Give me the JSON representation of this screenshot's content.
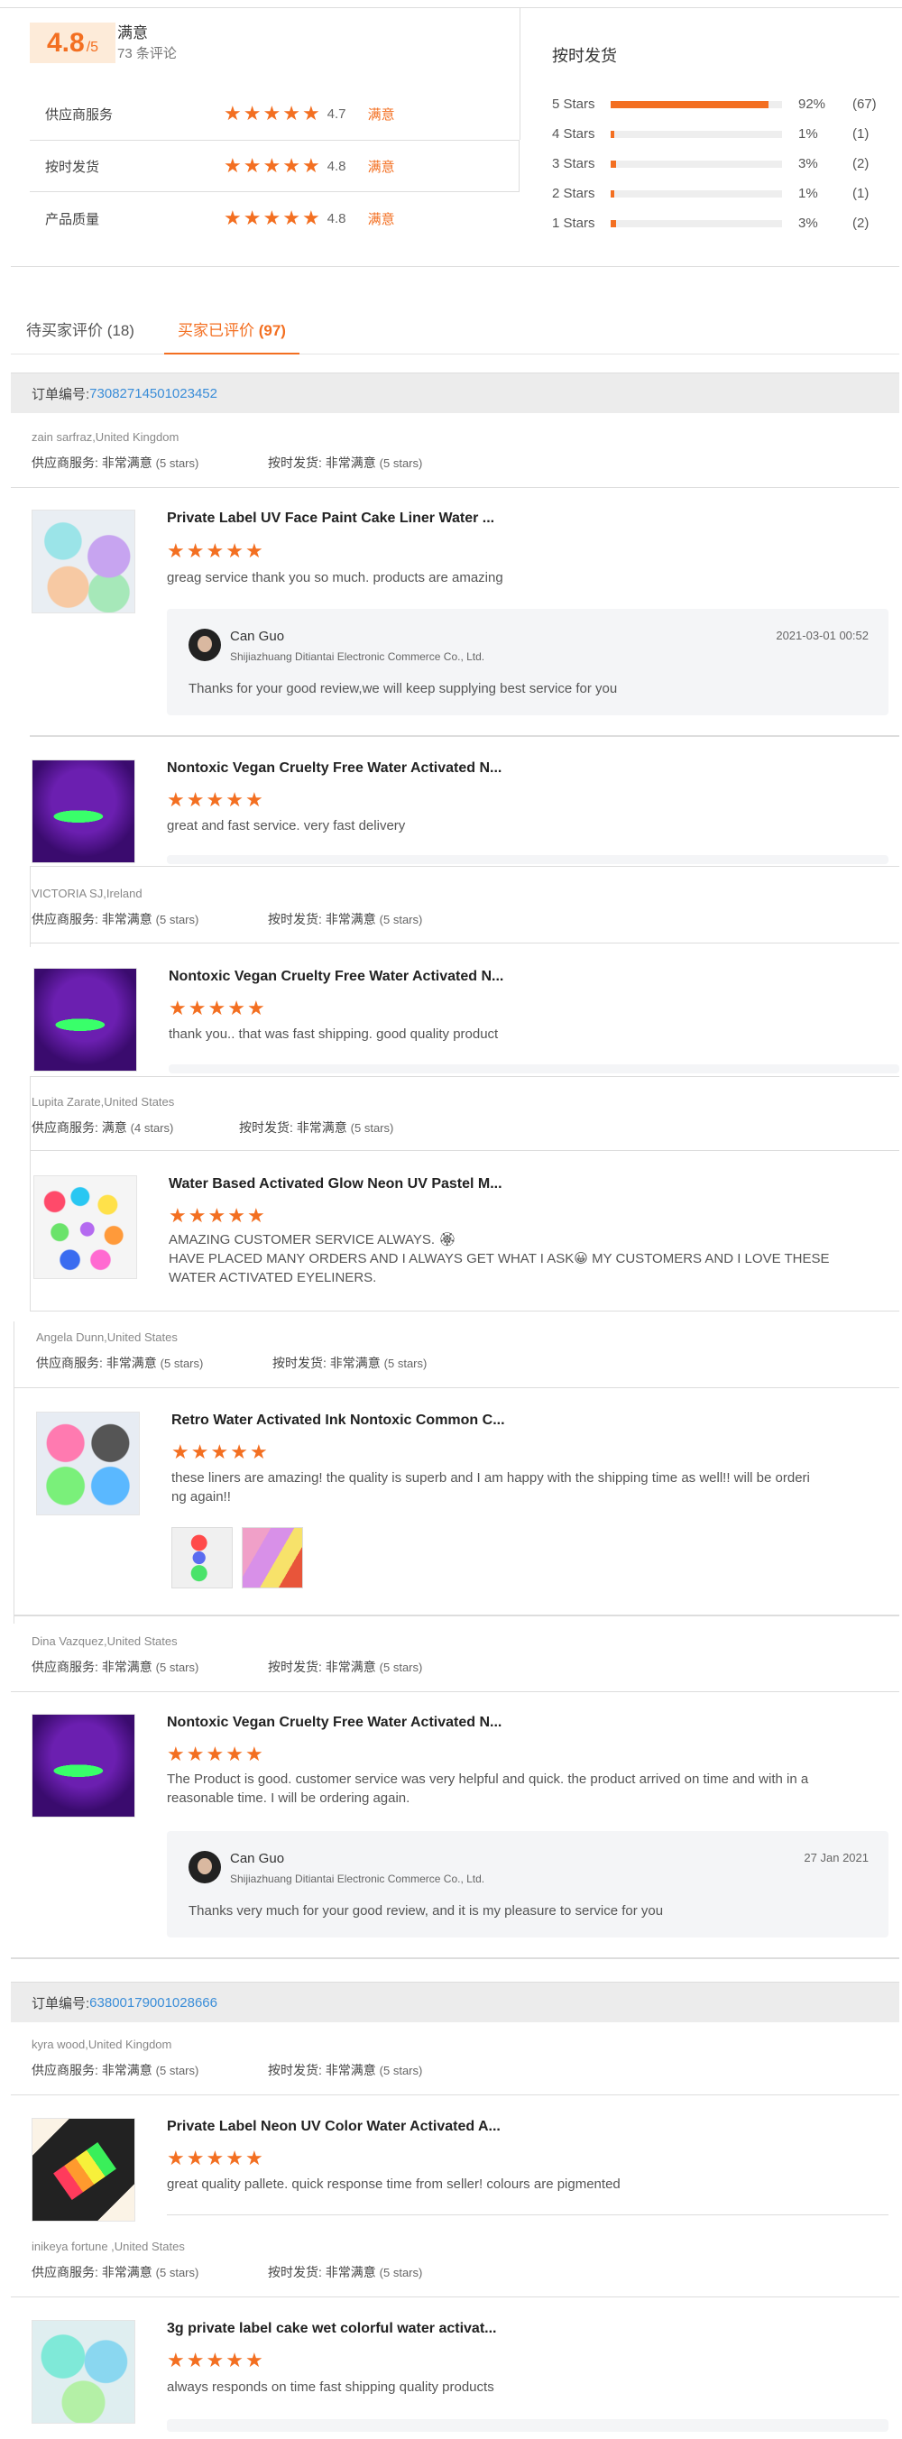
{
  "summary": {
    "score": "4.8",
    "score_suffix": "/5",
    "score_label": "满意",
    "review_count": "73 条评论",
    "ratings": [
      {
        "label": "供应商服务",
        "value": "4.7",
        "verdict": "满意",
        "stars": 4.7
      },
      {
        "label": "按时发货",
        "value": "4.8",
        "verdict": "满意",
        "stars": 4.8
      },
      {
        "label": "产品质量",
        "value": "4.8",
        "verdict": "满意",
        "stars": 4.8
      }
    ],
    "on_time_title": "按时发货",
    "distribution": [
      {
        "label": "5 Stars",
        "pct": "92%",
        "count": "(67)",
        "fraction": 0.92
      },
      {
        "label": "4 Stars",
        "pct": "1%",
        "count": "(1)",
        "fraction": 0.01
      },
      {
        "label": "3 Stars",
        "pct": "3%",
        "count": "(2)",
        "fraction": 0.03
      },
      {
        "label": "2 Stars",
        "pct": "1%",
        "count": "(1)",
        "fraction": 0.01
      },
      {
        "label": "1 Stars",
        "pct": "3%",
        "count": "(2)",
        "fraction": 0.03
      }
    ]
  },
  "tabs": {
    "pending": "待买家评价 (18)",
    "done_prefix": "买家已评价 ",
    "done_count": "(97)"
  },
  "orders": [
    {
      "label": "订单编号: ",
      "number": "73082714501023452"
    },
    {
      "label": "订单编号: ",
      "number": "63800179001028666"
    }
  ],
  "common": {
    "svc_label": "供应商服务: ",
    "ship_label": "按时发货: ",
    "very_sat": "非常满意",
    "sat": "满意",
    "five_stars": "(5 stars)",
    "four_stars": "(4 stars)",
    "star_glyph": "★"
  },
  "reviews": [
    {
      "user": "zain sarfraz,United Kingdom",
      "product": "Private Label UV Face Paint Cake Liner Water ...",
      "text": "greag service thank you so much. products are amazing",
      "reply": {
        "name": "Can Guo",
        "company": "Shijiazhuang Ditiantai Electronic Commerce Co., Ltd.",
        "date": "2021-03-01 00:52",
        "text": "Thanks for your good review,we will keep supplying best service for you"
      }
    },
    {
      "product": "Nontoxic Vegan Cruelty Free Water Activated N...",
      "text": "great and fast service. very fast delivery"
    },
    {
      "user": "VICTORIA SJ,Ireland",
      "product": "Nontoxic Vegan Cruelty Free Water Activated N...",
      "text": "thank you.. that was fast shipping. good quality product"
    },
    {
      "user": "Lupita Zarate,United States",
      "product": "Water Based Activated Glow Neon UV Pastel M...",
      "text1": "AMAZING CUSTOMER SERVICE ALWAYS. 🏵",
      "text2": "HAVE PLACED MANY ORDERS AND I ALWAYS GET WHAT I ASK😀   MY CUSTOMERS AND I LOVE THESE",
      "text3": "WATER ACTIVATED EYELINERS."
    },
    {
      "user": "Angela Dunn,United States",
      "product": "Retro Water Activated Ink Nontoxic Common C...",
      "text1": "these liners are amazing! the quality is superb and I am happy with the shipping time as well!! will be orderi",
      "text2": "ng again!!"
    },
    {
      "user": "Dina Vazquez,United States",
      "product": "Nontoxic Vegan Cruelty Free Water Activated N...",
      "text1": "The Product is good. customer service was very helpful and quick. the product arrived on time and with in a",
      "text2": "reasonable time. I will be ordering again.",
      "reply": {
        "name": "Can Guo",
        "company": "Shijiazhuang Ditiantai Electronic Commerce Co., Ltd.",
        "date": "27 Jan 2021",
        "text": "Thanks very much for your good review, and it is my pleasure to service for you"
      }
    },
    {
      "user": "kyra wood,United Kingdom",
      "product": "Private Label Neon UV Color Water Activated A...",
      "text": "great quality pallete. quick response time from seller! colours are pigmented"
    },
    {
      "user": "inikeya fortune ,United States",
      "product": "3g private label cake wet colorful water activat...",
      "text": "always responds on time fast shipping quality products"
    }
  ]
}
